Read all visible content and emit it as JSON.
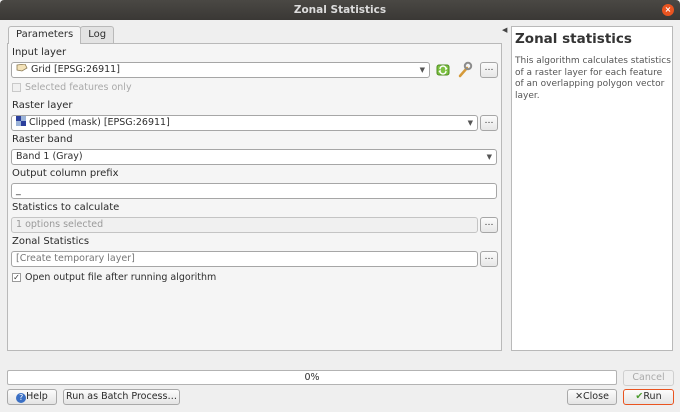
{
  "window": {
    "title": "Zonal Statistics",
    "close_glyph": "×"
  },
  "tabs": [
    {
      "label": "Parameters"
    },
    {
      "label": "Log"
    }
  ],
  "params": {
    "input_layer": {
      "label": "Input layer",
      "value": "Grid [EPSG:26911]"
    },
    "selected_only": {
      "label": "Selected features only",
      "checked": false
    },
    "raster_layer": {
      "label": "Raster layer",
      "value": "Clipped (mask) [EPSG:26911]"
    },
    "raster_band": {
      "label": "Raster band",
      "value": "Band 1 (Gray)"
    },
    "prefix": {
      "label": "Output column prefix",
      "value": "_"
    },
    "statistics": {
      "label": "Statistics to calculate",
      "value": "1 options selected"
    },
    "output": {
      "label": "Zonal Statistics",
      "placeholder": "[Create temporary layer]"
    },
    "open_after": {
      "label": "Open output file after running algorithm",
      "checked": true
    }
  },
  "help": {
    "title": "Zonal statistics",
    "text": "This algorithm calculates statistics of a raster layer for each feature of an overlapping polygon vector layer."
  },
  "progress": {
    "percent": 0,
    "label": "0%"
  },
  "buttons": {
    "cancel": "Cancel",
    "help": "Help",
    "batch": "Run as Batch Process…",
    "close": "Close",
    "run": "Run",
    "browse": "…"
  },
  "icons": {
    "combo_arrow": "▼",
    "checkmark": "✓",
    "collapse": "◀"
  },
  "colors": {
    "accent": "#e95420"
  }
}
